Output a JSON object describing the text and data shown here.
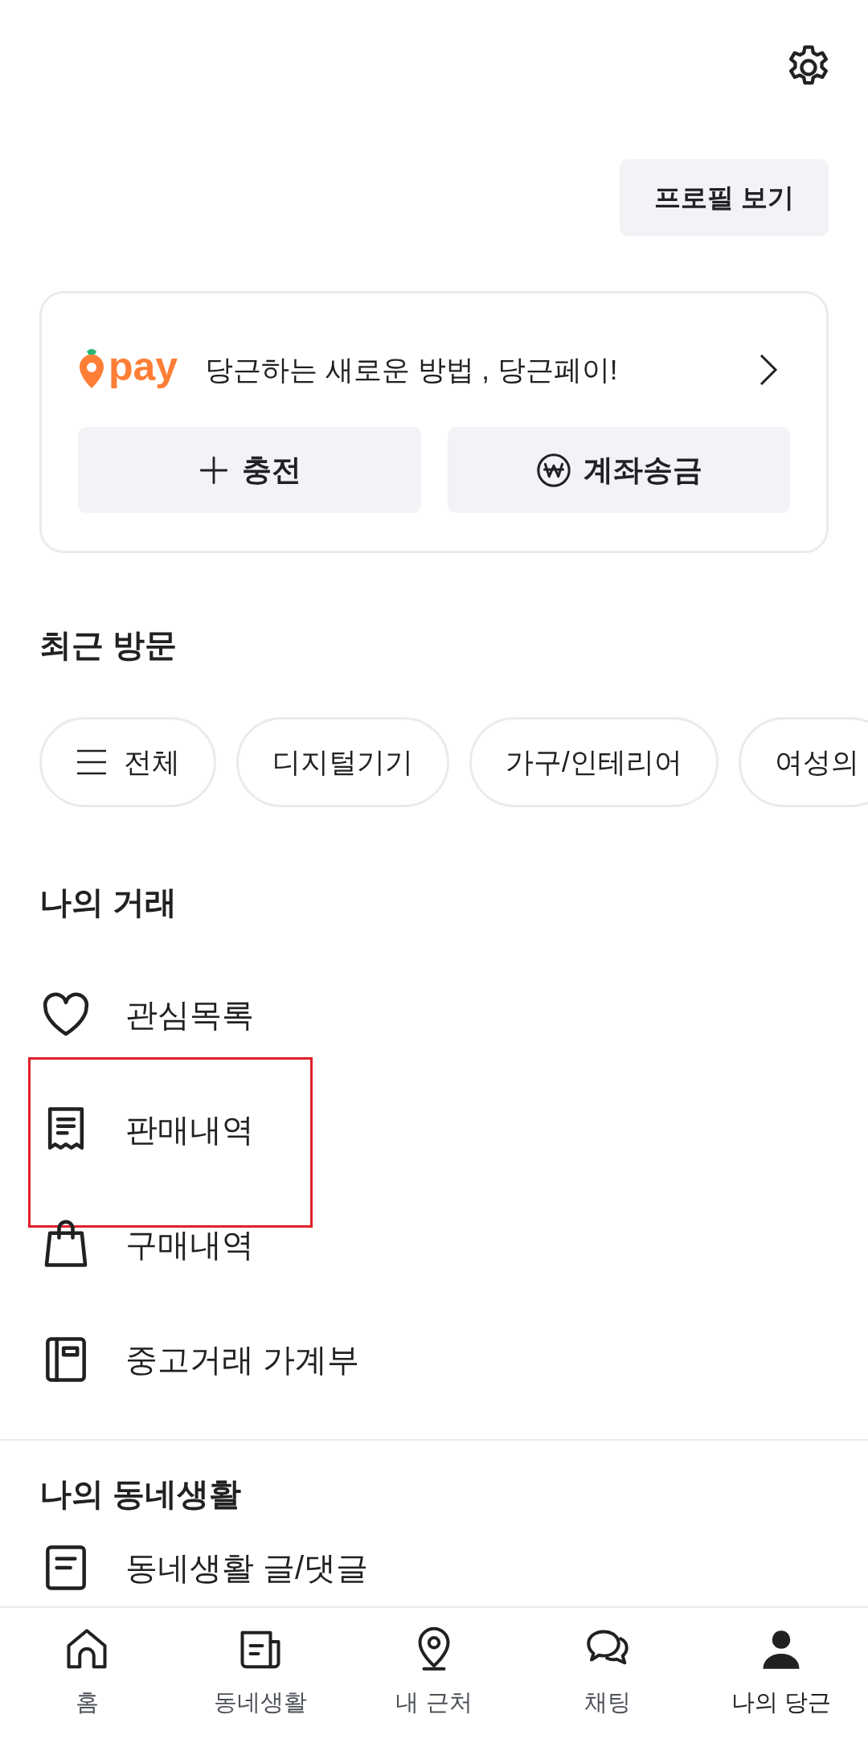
{
  "profile_button": "프로필 보기",
  "pay_card": {
    "logo": "pay",
    "slogan": "당근하는 새로운 방법 , 당근페이!",
    "buttons": [
      {
        "kind": "plus",
        "label": "충전"
      },
      {
        "kind": "won",
        "label": "계좌송금"
      }
    ]
  },
  "recent_visits": {
    "title": "최근 방문",
    "chips": [
      {
        "kind": "menu",
        "label": "전체"
      },
      {
        "kind": "plain",
        "label": "디지털기기"
      },
      {
        "kind": "plain",
        "label": "가구/인테리어"
      },
      {
        "kind": "plain",
        "label": "여성의"
      }
    ]
  },
  "my_trades": {
    "title": "나의 거래",
    "items": [
      {
        "kind": "heart",
        "label": "관심목록",
        "highlighted": false
      },
      {
        "kind": "receipt",
        "label": "판매내역",
        "highlighted": true
      },
      {
        "kind": "bag",
        "label": "구매내역",
        "highlighted": false
      },
      {
        "kind": "book",
        "label": "중고거래 가계부",
        "highlighted": false
      }
    ]
  },
  "my_neighborhood": {
    "title": "나의 동네생활",
    "items": [
      {
        "kind": "post",
        "label": "동네생활 글/댓글",
        "highlighted": false
      }
    ]
  },
  "bottom_nav": [
    {
      "kind": "home",
      "label": "홈",
      "selected": false
    },
    {
      "kind": "news",
      "label": "동네생활",
      "selected": false
    },
    {
      "kind": "pin",
      "label": "내 근처",
      "selected": false
    },
    {
      "kind": "chat",
      "label": "채팅",
      "selected": false
    },
    {
      "kind": "person",
      "label": "나의 당근",
      "selected": true
    }
  ]
}
